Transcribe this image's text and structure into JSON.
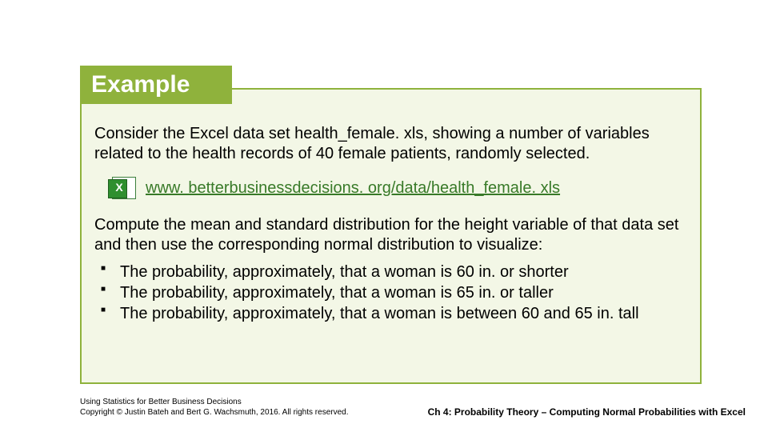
{
  "header": {
    "tab_label": "Example"
  },
  "content": {
    "para1": "Consider the Excel data set health_female. xls, showing a number of variables related to the health records of 40 female patients, randomly selected.",
    "link": {
      "icon_glyph": "X",
      "text": "www. betterbusinessdecisions. org/data/health_female. xls"
    },
    "para2": "Compute the mean and standard distribution for the height variable of that data set and then use the corresponding normal distribution to visualize:",
    "bullets": [
      "The probability, approximately, that a woman is 60 in. or shorter",
      "The probability, approximately, that a woman is 65 in. or taller",
      "The probability, approximately, that a woman is between 60 and 65 in. tall"
    ]
  },
  "footer": {
    "left_line1": "Using Statistics for Better Business Decisions",
    "left_line2": "Copyright © Justin Bateh and Bert G. Wachsmuth, 2016. All rights reserved.",
    "right": "Ch 4: Probability Theory – Computing Normal Probabilities with Excel"
  }
}
